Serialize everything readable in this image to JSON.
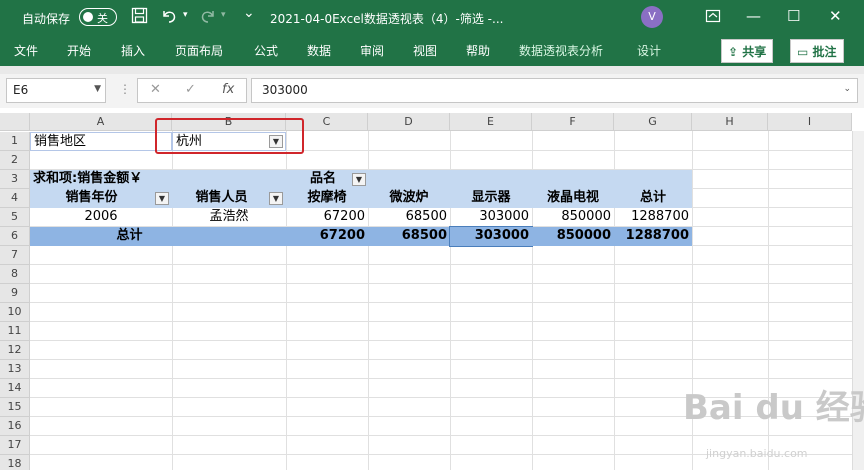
{
  "titlebar": {
    "autosave_label": "自动保存",
    "autosave_state": "关",
    "doc_title": "2021-04-0Excel数据透视表（4）-筛选  -...",
    "avatar_letter": "V",
    "minimize_glyph": "—",
    "restore_glyph": "☐",
    "close_glyph": "✕"
  },
  "ribbon": {
    "tabs": [
      "文件",
      "开始",
      "插入",
      "页面布局",
      "公式",
      "数据",
      "审阅",
      "视图",
      "帮助",
      "数据透视表分析",
      "设计"
    ],
    "share_label": "共享",
    "comment_label": "批注"
  },
  "formula_bar": {
    "name_box": "E6",
    "fx": "fx",
    "formula": "303000"
  },
  "sheet": {
    "columns": [
      "A",
      "B",
      "C",
      "D",
      "E",
      "F",
      "G",
      "H",
      "I"
    ],
    "rows": [
      "1",
      "2",
      "3",
      "4",
      "5",
      "6",
      "7",
      "8",
      "9",
      "10",
      "11",
      "12",
      "13",
      "14",
      "15",
      "16",
      "17",
      "18"
    ],
    "filter": {
      "label": "销售地区",
      "value": "杭州"
    },
    "pivot": {
      "sum_label": "求和项:销售金额￥",
      "col_field": "品名",
      "row_field_1": "销售年份",
      "row_field_2": "销售人员",
      "col_items": [
        "按摩椅",
        "微波炉",
        "显示器",
        "液晶电视",
        "总计"
      ],
      "data_row": {
        "year": "2006",
        "person": "孟浩然",
        "values": [
          "67200",
          "68500",
          "303000",
          "850000",
          "1288700"
        ]
      },
      "total_row": {
        "label": "总计",
        "values": [
          "67200",
          "68500",
          "303000",
          "850000",
          "1288700"
        ]
      }
    }
  },
  "watermark": {
    "main": "Bai du 经验",
    "sub": "jingyan.baidu.com"
  }
}
